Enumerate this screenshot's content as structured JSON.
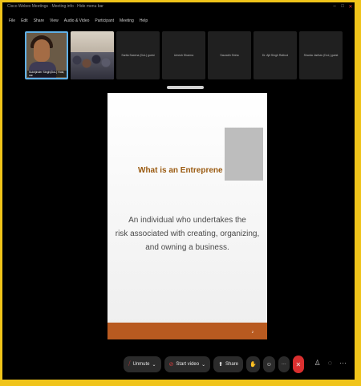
{
  "window": {
    "title": "Cisco Webex Meetings · Meeting info · Hide menu bar",
    "controls": [
      "–",
      "□",
      "✕"
    ]
  },
  "menu": [
    "File",
    "Edit",
    "Share",
    "View",
    "Audio & Video",
    "Participant",
    "Meeting",
    "Help"
  ],
  "participants": [
    {
      "caption": "Sukhjinder Singh(DoL) Host, me",
      "type": "self"
    },
    {
      "caption": "",
      "type": "room"
    },
    {
      "name": "Sarita Saxena (DoL) guest",
      "type": "name"
    },
    {
      "name": "Umesh Sharma",
      "type": "name"
    },
    {
      "name": "Saurabh Sinha",
      "type": "name"
    },
    {
      "name": "Dr. Ajit Singh Rathod",
      "type": "name"
    },
    {
      "name": "Sharda Jadhav (DoL) guest",
      "type": "name"
    }
  ],
  "slide": {
    "title": "What is an Entreprene",
    "body_lines": [
      "An individual who undertakes the",
      "risk associated with creating, organizing,",
      "and owning a business."
    ],
    "page_number": "2",
    "footer_color": "#b85a20"
  },
  "controls": {
    "unmute": "Unmute",
    "start_video": "Start video",
    "share": "Share",
    "more": "···",
    "end": "✕"
  },
  "icons": {
    "mic": "mic-muted-icon",
    "video": "video-off-icon",
    "share": "share-icon",
    "raise_hand": "raise-hand-icon",
    "reactions": "emoji-icon",
    "end_call": "end-call-icon",
    "participants": "participants-icon",
    "chat": "chat-icon",
    "more": "more-icon"
  }
}
